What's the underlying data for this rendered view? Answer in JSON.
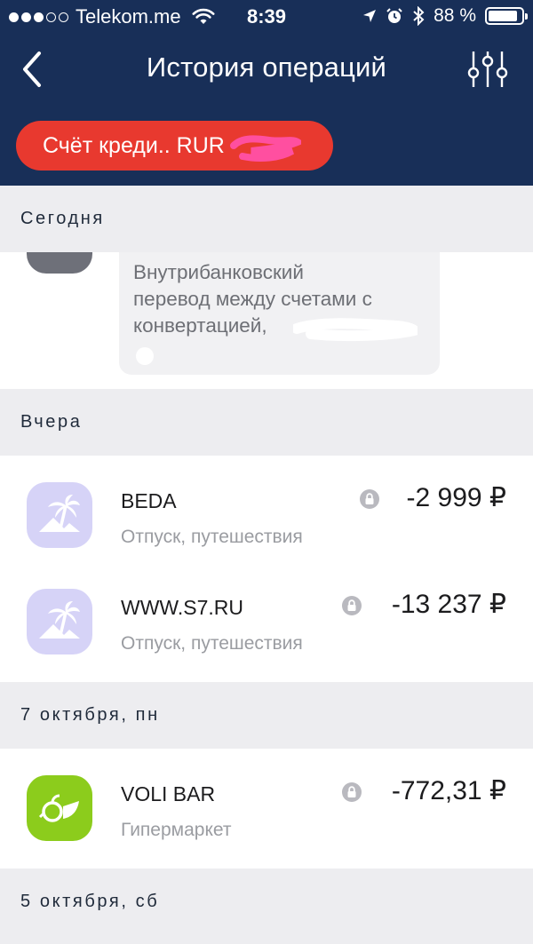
{
  "status_bar": {
    "carrier": "Telekom.me",
    "time": "8:39",
    "battery": "88 %",
    "battery_level": 0.88,
    "signal_bars_filled": 3,
    "signal_bars_total": 5
  },
  "nav": {
    "title": "История операций",
    "back_icon": "chevron-left-icon",
    "filter_icon": "sliders-icon"
  },
  "account_chip": {
    "label": "Счёт креди.. RUR"
  },
  "colors": {
    "header_bg": "#182f58",
    "chip_bg": "#e8392f",
    "travel_icon_bg": "#d6d3f7",
    "grocery_icon_bg": "#8ccc1c"
  },
  "sections": [
    {
      "title": "Сегодня",
      "items": [
        {
          "description": "Внутрибанковский перевод между счетами с конвертацией,",
          "line1": "Внутрибанковский",
          "line2": "перевод между счетами с",
          "line3": "конвертацией,"
        }
      ]
    },
    {
      "title": "Вчера",
      "items": [
        {
          "name": "BEDA",
          "category": "Отпуск, путешествия",
          "amount": "-2 999 ₽",
          "icon": "palm-tree-icon"
        },
        {
          "name": "WWW.S7.RU",
          "category": "Отпуск, путешествия",
          "amount": "-13 237 ₽",
          "icon": "palm-tree-icon"
        }
      ]
    },
    {
      "title": "7 октября, пн",
      "items": [
        {
          "name": "VOLI BAR",
          "category": "Гипермаркет",
          "amount": "-772,31 ₽",
          "icon": "grocery-basket-icon"
        }
      ]
    },
    {
      "title": "5 октября, сб",
      "items": []
    }
  ]
}
